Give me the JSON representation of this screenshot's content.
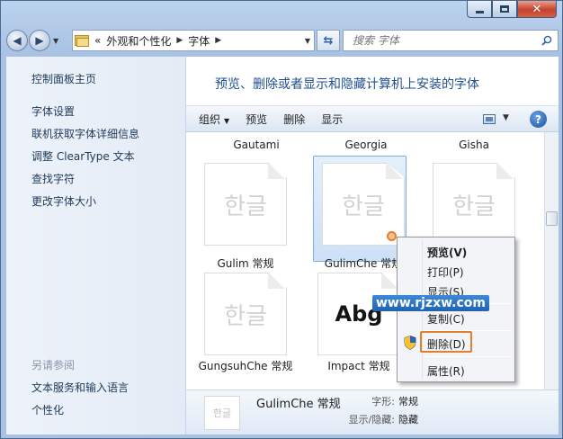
{
  "address": {
    "chevrons": "«",
    "crumbs": [
      "外观和个性化",
      "字体"
    ]
  },
  "search": {
    "placeholder": "搜索 字体"
  },
  "left_pane": {
    "home": "控制面板主页",
    "links": [
      "字体设置",
      "联机获取字体详细信息",
      "调整 ClearType 文本",
      "查找字符",
      "更改字体大小"
    ],
    "see_also_title": "另请参阅",
    "see_also_links": [
      "文本服务和输入语言",
      "个性化"
    ]
  },
  "main": {
    "title": "预览、删除或者显示和隐藏计算机上安装的字体"
  },
  "toolbar": {
    "organize": "组织",
    "preview": "预览",
    "delete": "删除",
    "show": "显示"
  },
  "fonts": {
    "top_labels": [
      "Gautami",
      "Georgia",
      "Gisha"
    ],
    "row1": [
      {
        "name": "Gulim 常规",
        "sample": "한글"
      },
      {
        "name": "GulimChe 常规",
        "sample": "한글"
      },
      {
        "name": "",
        "sample": "한글"
      }
    ],
    "row2": [
      {
        "name": "GungsuhChe 常规",
        "sample": "한글"
      },
      {
        "name": "Impact 常规",
        "sample": "Abg"
      }
    ]
  },
  "details": {
    "thumb_sample": "한글",
    "name": "GulimChe 常规",
    "style_label": "字形:",
    "style_value": "常规",
    "visibility_label": "显示/隐藏:",
    "visibility_value": "隐藏"
  },
  "context_menu": {
    "items": [
      "预览(V)",
      "打印(P)",
      "显示(S)",
      "复制(C)",
      "删除(D)",
      "属性(R)"
    ]
  },
  "watermark": "www.rjzxw.com",
  "colors": {
    "link": "#1e395b",
    "title": "#1d4f91",
    "highlight": "#e0802f",
    "selection": "#cde0f6"
  }
}
